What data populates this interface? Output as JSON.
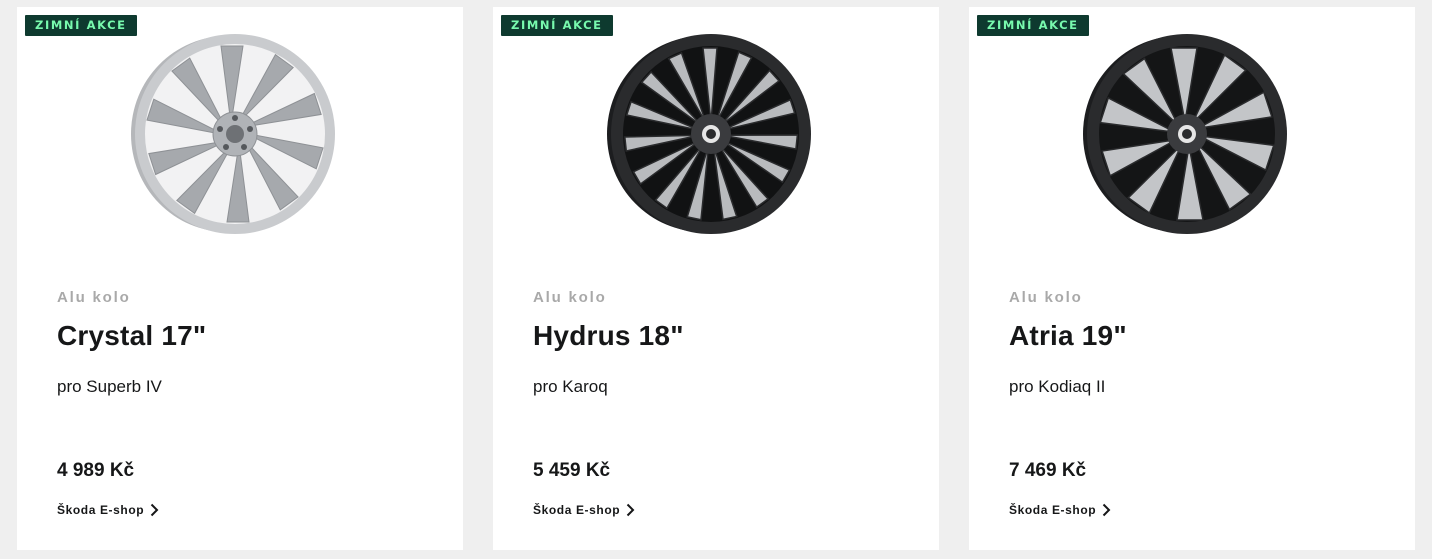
{
  "cards": [
    {
      "badge": "ZIMNÍ AKCE",
      "kind": "Alu kolo",
      "title": "Crystal 17\"",
      "model": "pro Superb IV",
      "price": "4 989 Kč",
      "link": "Škoda E-shop",
      "wheel_style": "silver"
    },
    {
      "badge": "ZIMNÍ AKCE",
      "kind": "Alu kolo",
      "title": "Hydrus 18\"",
      "model": "pro Karoq",
      "price": "5 459 Kč",
      "link": "Škoda E-shop",
      "wheel_style": "dark"
    },
    {
      "badge": "ZIMNÍ AKCE",
      "kind": "Alu kolo",
      "title": "Atria 19\"",
      "model": "pro Kodiaq II",
      "price": "7 469 Kč",
      "link": "Škoda E-shop",
      "wheel_style": "dark"
    }
  ],
  "colors": {
    "badge_bg": "#0e3a2f",
    "badge_text": "#78faae",
    "text": "#161718",
    "muted": "#a9a9a9"
  },
  "icons": {
    "link_arrow": "chevron-right-icon"
  }
}
